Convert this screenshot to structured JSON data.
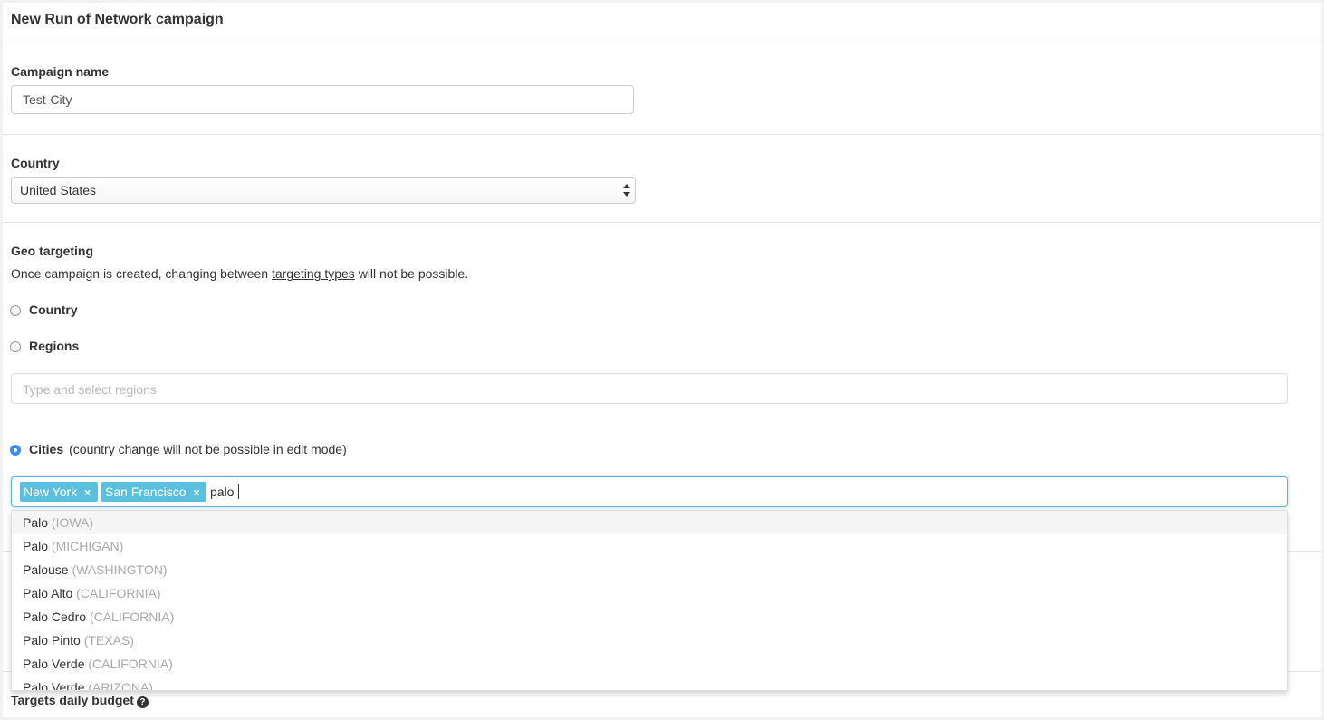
{
  "header": {
    "title": "New Run of Network campaign"
  },
  "campaign_name": {
    "label": "Campaign name",
    "value": "Test-City"
  },
  "country": {
    "label": "Country",
    "selected": "United States"
  },
  "geo": {
    "label": "Geo targeting",
    "help_prefix": "Once campaign is created, changing between ",
    "help_link": "targeting types",
    "help_suffix": " will not be possible.",
    "options": {
      "country": "Country",
      "regions": "Regions",
      "cities": "Cities",
      "cities_note": "(country change will not be possible in edit mode)"
    },
    "selected_option": "cities",
    "regions_placeholder": "Type and select regions",
    "cities_tags": [
      "New York",
      "San Francisco"
    ],
    "tag_remove": "×",
    "cities_query": "palo",
    "suggestions": [
      {
        "city": "Palo",
        "region": "(IOWA)"
      },
      {
        "city": "Palo",
        "region": "(MICHIGAN)"
      },
      {
        "city": "Palouse",
        "region": "(WASHINGTON)"
      },
      {
        "city": "Palo Alto",
        "region": "(CALIFORNIA)"
      },
      {
        "city": "Palo Cedro",
        "region": "(CALIFORNIA)"
      },
      {
        "city": "Palo Pinto",
        "region": "(TEXAS)"
      },
      {
        "city": "Palo Verde",
        "region": "(CALIFORNIA)"
      },
      {
        "city": "Palo Verde",
        "region": "(ARIZONA)"
      }
    ]
  },
  "budget": {
    "label": "Targets daily budget",
    "help_icon": "question-circle-icon"
  },
  "colors": {
    "tag_bg": "#5bc0de",
    "radio_checked": "#3b8ff2",
    "focus_border": "#66afe9"
  }
}
